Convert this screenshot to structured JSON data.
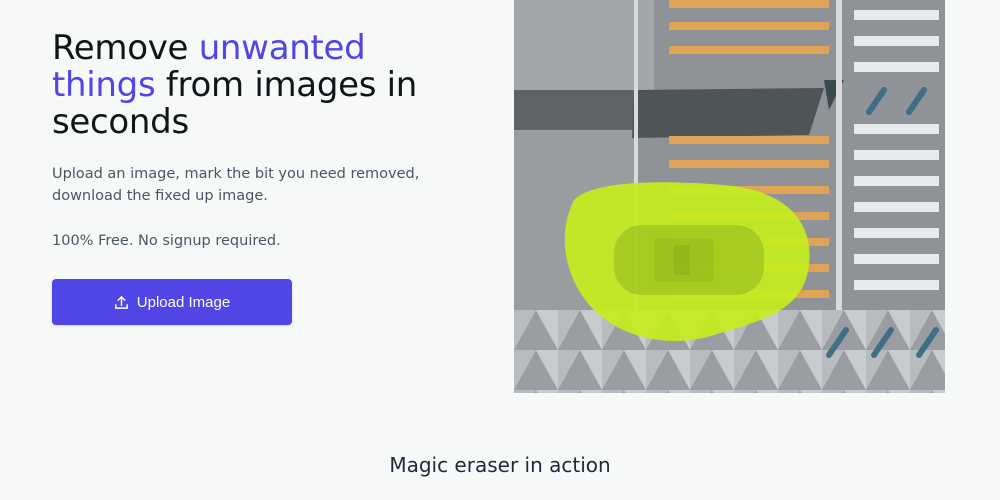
{
  "hero": {
    "headline_part1": "Remove ",
    "headline_accent": "unwanted things",
    "headline_part2": " from images in seconds",
    "subtext": "Upload an image, mark the bit you need removed, download the fixed up image.",
    "free_text": "100% Free. No signup required.",
    "upload_button_label": "Upload Image",
    "upload_icon": "upload-icon"
  },
  "preview": {
    "image": "aerial-crosswalk-car-with-mask",
    "mask_color": "#c7f01c"
  },
  "section": {
    "title": "Magic eraser in action"
  },
  "colors": {
    "accent": "#4f46e5",
    "background": "#f7f9f9",
    "heading": "#111418",
    "body_text": "#4b5563"
  }
}
